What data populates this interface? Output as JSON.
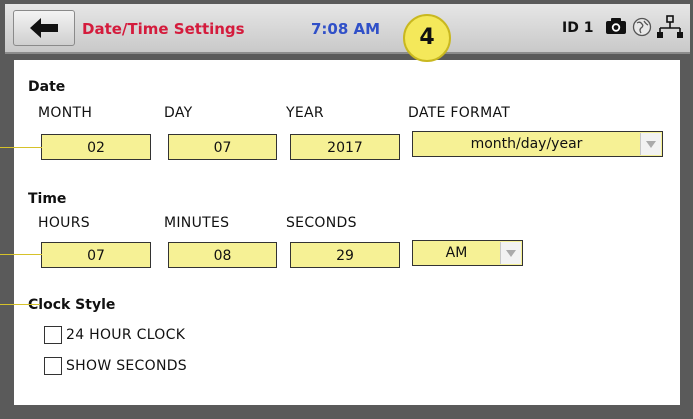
{
  "header": {
    "title": "Date/Time Settings",
    "time": "7:08 AM",
    "callout": "4",
    "id_label": "ID 1",
    "colors": {
      "title": "#d41b3c",
      "time": "#3050c8"
    }
  },
  "date": {
    "section_label": "Date",
    "month_label": "MONTH",
    "day_label": "DAY",
    "year_label": "YEAR",
    "format_label": "DATE FORMAT",
    "month_value": "02",
    "day_value": "07",
    "year_value": "2017",
    "format_value": "month/day/year"
  },
  "time": {
    "section_label": "Time",
    "hours_label": "HOURS",
    "minutes_label": "MINUTES",
    "seconds_label": "SECONDS",
    "hours_value": "07",
    "minutes_value": "08",
    "seconds_value": "29",
    "ampm_value": "AM"
  },
  "clock_style": {
    "section_label": "Clock Style",
    "options": [
      {
        "label": "24 HOUR CLOCK",
        "checked": false
      },
      {
        "label": "SHOW SECONDS",
        "checked": false
      }
    ]
  }
}
